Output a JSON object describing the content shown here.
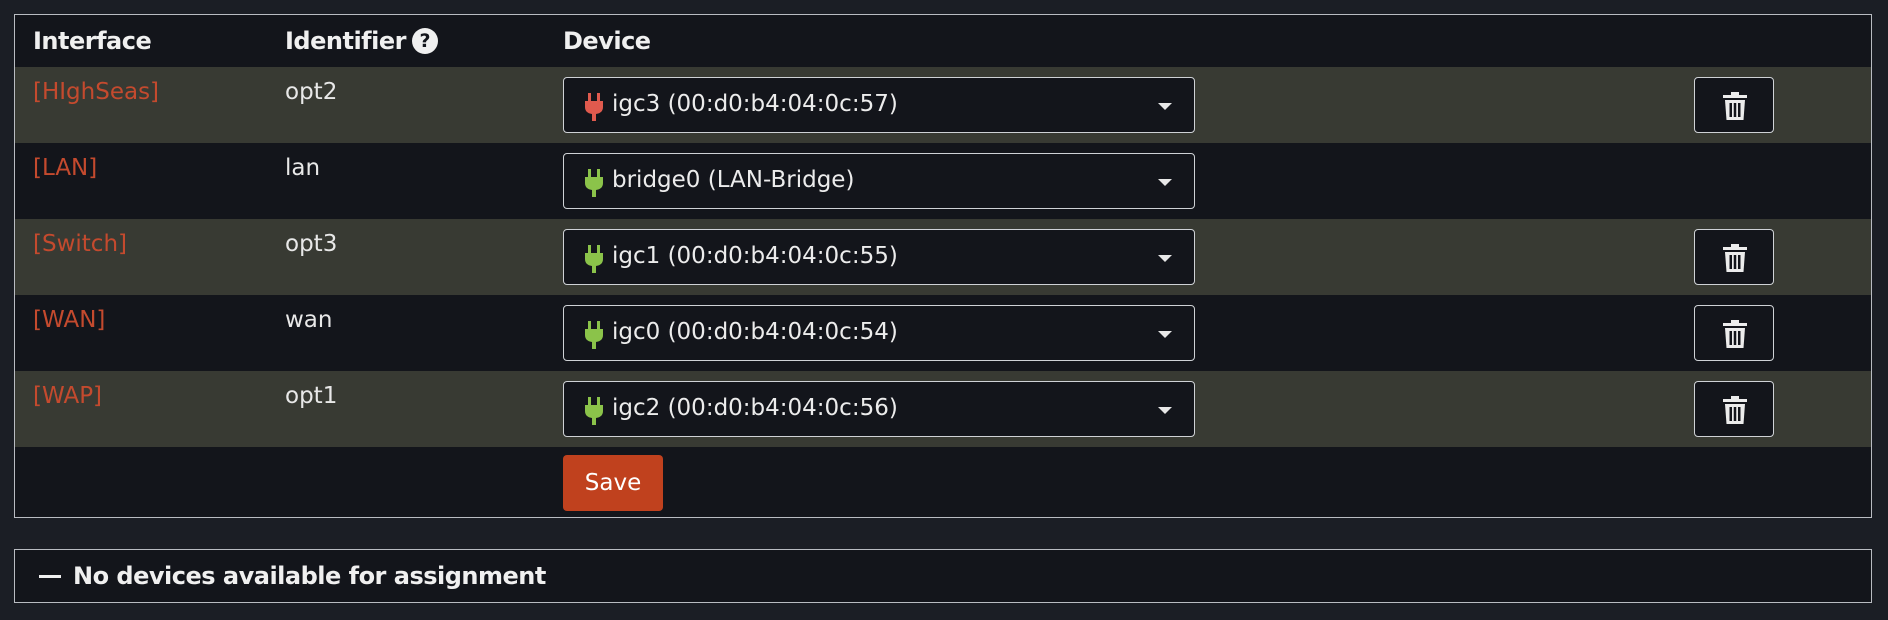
{
  "table": {
    "headers": {
      "interface": "Interface",
      "identifier": "Identifier",
      "device": "Device"
    },
    "rows": [
      {
        "interface": "[HIghSeas]",
        "identifier": "opt2",
        "device": "igc3 (00:d0:b4:04:0c:57)",
        "plug_color": "#e05a4e",
        "deletable": true
      },
      {
        "interface": "[LAN]",
        "identifier": "lan",
        "device": "bridge0 (LAN-Bridge)",
        "plug_color": "#8bc34a",
        "deletable": false
      },
      {
        "interface": "[Switch]",
        "identifier": "opt3",
        "device": "igc1 (00:d0:b4:04:0c:55)",
        "plug_color": "#8bc34a",
        "deletable": true
      },
      {
        "interface": "[WAN]",
        "identifier": "wan",
        "device": "igc0 (00:d0:b4:04:0c:54)",
        "plug_color": "#8bc34a",
        "deletable": true
      },
      {
        "interface": "[WAP]",
        "identifier": "opt1",
        "device": "igc2 (00:d0:b4:04:0c:56)",
        "plug_color": "#8bc34a",
        "deletable": true
      }
    ],
    "save_label": "Save"
  },
  "unassigned": {
    "title": "No devices available for assignment"
  },
  "colors": {
    "accent": "#c0411e",
    "link_red": "#c44a2e",
    "plug_connected": "#8bc34a",
    "plug_disconnected": "#e05a4e"
  }
}
